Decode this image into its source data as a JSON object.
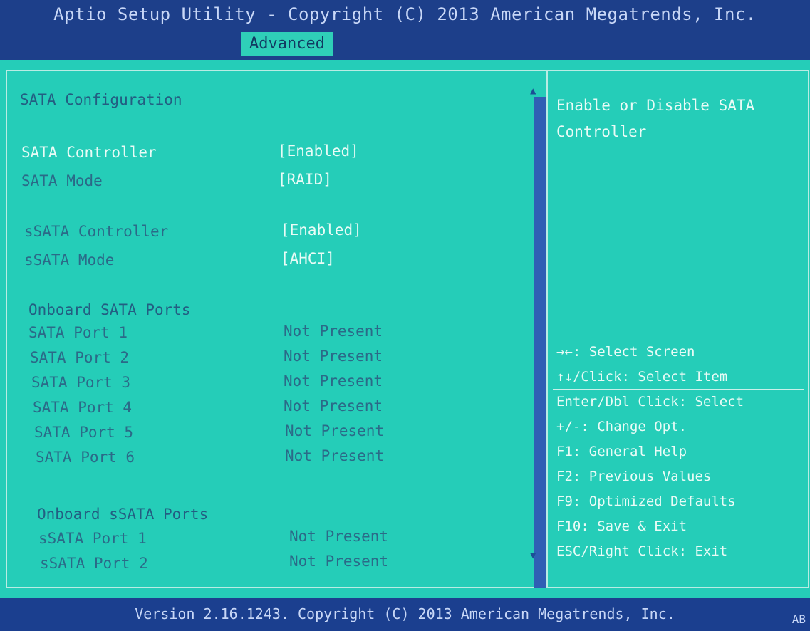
{
  "header": {
    "title": "Aptio Setup Utility - Copyright (C) 2013 American Megatrends, Inc.",
    "active_tab": "Advanced"
  },
  "main": {
    "heading": "SATA Configuration",
    "settings": [
      {
        "label": "SATA Controller",
        "value": "[Enabled]"
      },
      {
        "label": "SATA Mode",
        "value": "[RAID]"
      },
      {
        "label": "sSATA Controller",
        "value": "[Enabled]"
      },
      {
        "label": "sSATA Mode",
        "value": "[AHCI]"
      }
    ],
    "onboard_sata": {
      "heading": "Onboard SATA Ports",
      "ports": [
        {
          "label": "SATA Port 1",
          "value": "Not Present"
        },
        {
          "label": "SATA Port 2",
          "value": "Not Present"
        },
        {
          "label": "SATA Port 3",
          "value": "Not Present"
        },
        {
          "label": "SATA Port 4",
          "value": "Not Present"
        },
        {
          "label": "SATA Port 5",
          "value": "Not Present"
        },
        {
          "label": "SATA Port 6",
          "value": "Not Present"
        }
      ]
    },
    "onboard_ssata": {
      "heading": "Onboard sSATA Ports",
      "ports": [
        {
          "label": "sSATA Port 1",
          "value": "Not Present"
        },
        {
          "label": "sSATA Port 2",
          "value": "Not Present"
        }
      ]
    }
  },
  "help": {
    "description_line1": "Enable or Disable SATA",
    "description_line2": "Controller",
    "keys": [
      "→←: Select Screen",
      "↑↓/Click: Select Item",
      "Enter/Dbl Click: Select",
      "+/-: Change Opt.",
      "F1: General Help",
      "F2: Previous Values",
      "F9: Optimized Defaults",
      "F10: Save & Exit",
      "ESC/Right Click: Exit"
    ]
  },
  "footer": {
    "version_text": "Version 2.16.1243. Copyright (C) 2013 American Megatrends, Inc.",
    "corner_text": "AB"
  },
  "colors": {
    "header_bg": "#1d3f8a",
    "main_bg": "#25cdb8",
    "selected_text": "#e9fbf6",
    "label_text": "#2b6a88",
    "scrollbar": "#2f5fb4"
  },
  "icons": {
    "scroll_up": "up-triangle-icon",
    "scroll_down": "down-triangle-icon"
  }
}
